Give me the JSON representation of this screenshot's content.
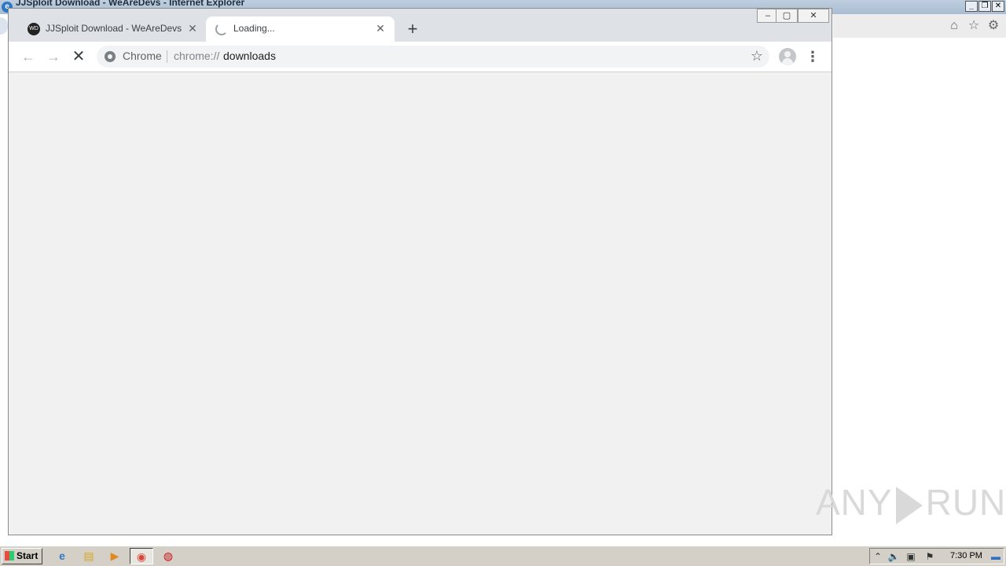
{
  "ie": {
    "title": "JJSploit Download - WeAreDevs - Internet Explorer",
    "buttons": {
      "minimize": "_",
      "restore": "❐",
      "close": "✕"
    }
  },
  "chrome": {
    "tabs": [
      {
        "title": "JJSploit Download - WeAreDevs",
        "favicon": "wearedevs-favicon",
        "active": false
      },
      {
        "title": "Loading...",
        "favicon": "loading-spinner-icon",
        "active": true
      }
    ],
    "omnibox": {
      "chip": "Chrome",
      "url_scheme": "chrome://",
      "url_host": "downloads"
    }
  },
  "watermark": {
    "left": "ANY",
    "right": "RUN"
  },
  "taskbar": {
    "start_label": "Start",
    "apps": [
      "internet-explorer-icon",
      "file-explorer-icon",
      "media-player-icon",
      "chrome-icon",
      "opera-icon"
    ],
    "clock": "7:30 PM"
  },
  "colors": {
    "tabstrip": "#dee1e6",
    "content_bg": "#f1f1f1",
    "taskbar": "#d4d0c8"
  }
}
